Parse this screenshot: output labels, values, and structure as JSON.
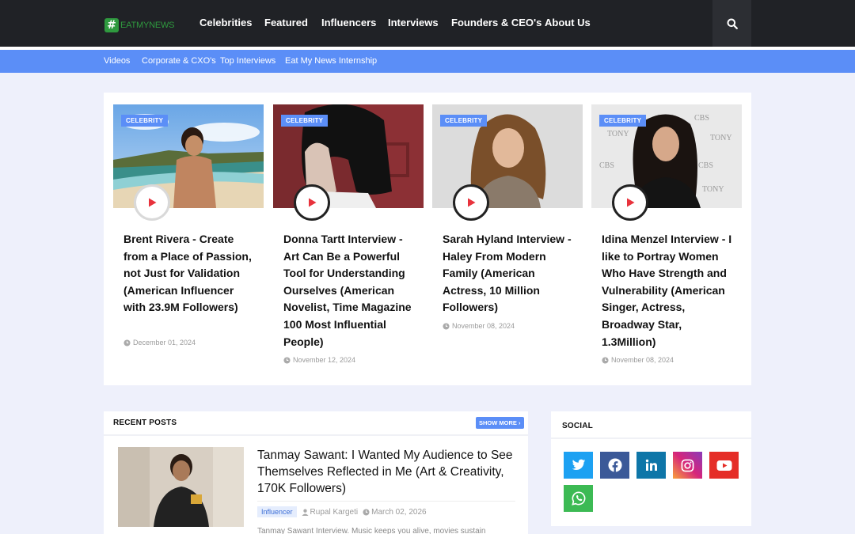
{
  "brand": {
    "name": "EATMYNEWS",
    "mark": "#"
  },
  "nav": {
    "items": [
      "Celebrities",
      "Featured",
      "Influencers",
      "Interviews",
      "Founders & CEO's",
      "About Us"
    ]
  },
  "subnav": {
    "items": [
      "Videos",
      "Corporate & CXO's",
      "Top Interviews",
      "Eat My News Internship"
    ]
  },
  "featured": {
    "cards": [
      {
        "badge": "CELEBRITY",
        "title": "Brent Rivera - Create from a Place of Passion, not Just for Validation (American Influencer with 23.9M Followers)",
        "date": "December 01, 2024"
      },
      {
        "badge": "CELEBRITY",
        "title": "Donna Tartt Interview - Art Can Be a Powerful Tool for Understanding Ourselves (American Novelist, Time Magazine 100 Most Influential People)",
        "date": "November 12, 2024"
      },
      {
        "badge": "CELEBRITY",
        "title": "Sarah Hyland Interview - Haley From Modern Family (American Actress, 10 Million Followers)",
        "date": "November 08, 2024"
      },
      {
        "badge": "CELEBRITY",
        "title": "Idina Menzel Interview - I like to Portray Women Who Have Strength and Vulnerability (American Singer, Actress, Broadway Star, 1.3Million)",
        "date": "November 08, 2024"
      }
    ]
  },
  "recent": {
    "heading": "RECENT POSTS",
    "show_more": "SHOW MORE",
    "post": {
      "title": "Tanmay Sawant: I Wanted My Audience to See Themselves Reflected in Me (Art & Creativity, 170K Followers)",
      "tag": "Influencer",
      "author": "Rupal Kargeti",
      "date": "March 02, 2026",
      "snippet": "Tanmay Sawant Interview. Music keeps you alive, movies sustain"
    }
  },
  "social": {
    "heading": "SOCIAL",
    "icons": [
      {
        "name": "twitter-icon",
        "color": "#1da1f2"
      },
      {
        "name": "facebook-icon",
        "color": "#3b5998"
      },
      {
        "name": "linkedin-icon",
        "color": "#0e76a8"
      },
      {
        "name": "instagram-icon",
        "color": "#c13584"
      },
      {
        "name": "youtube-icon",
        "color": "#e52d27"
      },
      {
        "name": "whatsapp-icon",
        "color": "#3cba54"
      }
    ]
  },
  "colors": {
    "accent": "#5b8ef7",
    "topbar": "#202226",
    "play": "#e8333d"
  }
}
